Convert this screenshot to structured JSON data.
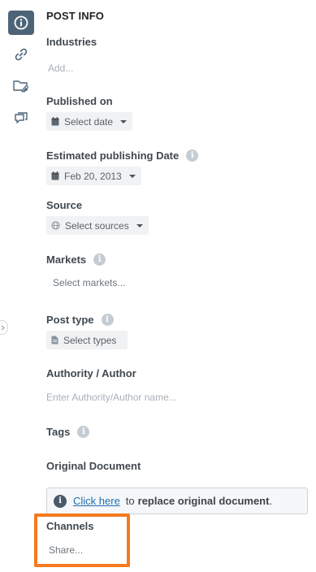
{
  "panel": {
    "title": "POST INFO"
  },
  "rail": {
    "items": [
      {
        "icon": "info-icon",
        "active": true
      },
      {
        "icon": "link-icon",
        "active": false
      },
      {
        "icon": "folder-attachment-icon",
        "active": false
      },
      {
        "icon": "comments-icon",
        "active": false
      }
    ]
  },
  "fields": {
    "industries": {
      "label": "Industries",
      "placeholder": "Add..."
    },
    "published_on": {
      "label": "Published on",
      "value": "Select date"
    },
    "estimated_date": {
      "label": "Estimated publishing Date",
      "value": "Feb 20, 2013"
    },
    "source": {
      "label": "Source",
      "value": "Select sources"
    },
    "markets": {
      "label": "Markets",
      "placeholder": "Select markets..."
    },
    "post_type": {
      "label": "Post type",
      "value": "Select types"
    },
    "author": {
      "label": "Authority / Author",
      "placeholder": "Enter Authority/Author name..."
    },
    "tags": {
      "label": "Tags"
    },
    "original_document": {
      "label": "Original Document",
      "link_text": "Click here",
      "middle_text": "to",
      "action_text": "replace original document",
      "end_text": "."
    },
    "channels": {
      "label": "Channels",
      "placeholder": "Share..."
    }
  },
  "colors": {
    "active_rail": "#4d6478",
    "highlight": "#f47a20",
    "link": "#1f6fb2"
  }
}
